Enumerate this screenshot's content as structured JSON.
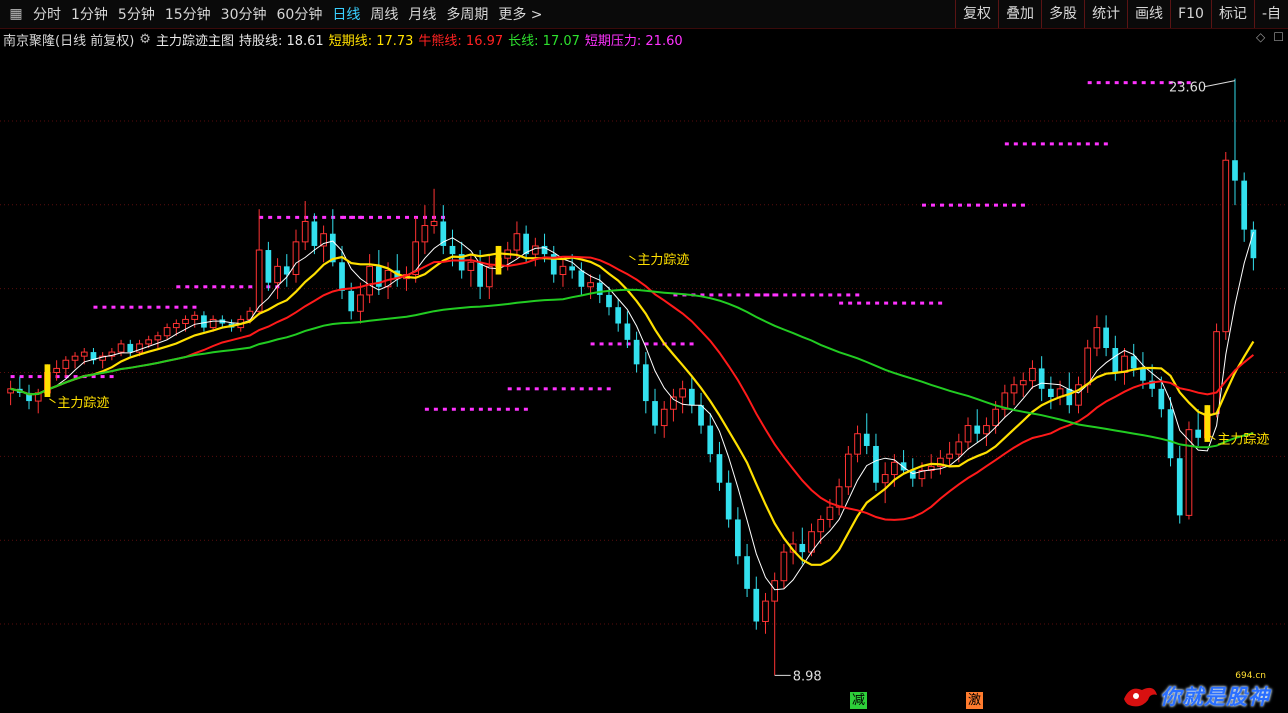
{
  "toolbar": {
    "periods": [
      "分时",
      "1分钟",
      "5分钟",
      "15分钟",
      "30分钟",
      "60分钟",
      "日线",
      "周线",
      "月线",
      "多周期",
      "更多 >"
    ],
    "active_period": "日线",
    "right_buttons": [
      "复权",
      "叠加",
      "多股",
      "统计",
      "画线",
      "F10",
      "标记",
      "-自"
    ]
  },
  "infobar": {
    "stock_name": "南京聚隆(日线 前复权)",
    "indicator_name": "主力踪迹主图",
    "fields": [
      {
        "label": "持股线:",
        "value": "18.61",
        "color": "#e8e8e8"
      },
      {
        "label": "短期线:",
        "value": "17.73",
        "color": "#ffe000"
      },
      {
        "label": "牛熊线:",
        "value": "16.97",
        "color": "#ff2222"
      },
      {
        "label": "长线:",
        "value": "17.07",
        "color": "#2ee02e"
      },
      {
        "label": "短期压力:",
        "value": "21.60",
        "color": "#ff33ff"
      }
    ]
  },
  "chart_data": {
    "type": "candlestick",
    "price_high_label": "23.60",
    "price_low_label": "8.98",
    "annotation_text": "主力踪迹",
    "colors": {
      "up": "#ff3333",
      "down": "#33e0ee",
      "hold_line": "#ffffff",
      "short_line": "#ffe000",
      "bull_bear_line": "#ff1a1a",
      "long_line": "#22cc22",
      "pressure": "#ff33ff"
    },
    "candles": [
      [
        15.9,
        16.2,
        15.6,
        16.0
      ],
      [
        16.0,
        16.3,
        15.8,
        15.9
      ],
      [
        15.9,
        16.1,
        15.5,
        15.7
      ],
      [
        15.7,
        16.0,
        15.4,
        15.9
      ],
      [
        15.9,
        16.6,
        15.8,
        16.4
      ],
      [
        16.4,
        16.7,
        16.2,
        16.5
      ],
      [
        16.5,
        16.8,
        16.3,
        16.7
      ],
      [
        16.7,
        16.9,
        16.5,
        16.8
      ],
      [
        16.8,
        17.0,
        16.6,
        16.9
      ],
      [
        16.9,
        17.0,
        16.6,
        16.7
      ],
      [
        16.7,
        16.9,
        16.5,
        16.8
      ],
      [
        16.8,
        17.0,
        16.7,
        16.9
      ],
      [
        16.9,
        17.2,
        16.8,
        17.1
      ],
      [
        17.1,
        17.2,
        16.8,
        16.9
      ],
      [
        16.9,
        17.2,
        16.8,
        17.1
      ],
      [
        17.1,
        17.3,
        17.0,
        17.2
      ],
      [
        17.2,
        17.4,
        17.0,
        17.3
      ],
      [
        17.3,
        17.6,
        17.2,
        17.5
      ],
      [
        17.5,
        17.7,
        17.3,
        17.6
      ],
      [
        17.6,
        17.8,
        17.4,
        17.7
      ],
      [
        17.7,
        17.9,
        17.5,
        17.8
      ],
      [
        17.8,
        17.9,
        17.4,
        17.5
      ],
      [
        17.5,
        17.8,
        17.4,
        17.7
      ],
      [
        17.7,
        17.8,
        17.5,
        17.6
      ],
      [
        17.6,
        17.7,
        17.4,
        17.5
      ],
      [
        17.5,
        17.8,
        17.4,
        17.7
      ],
      [
        17.7,
        18.0,
        17.6,
        17.9
      ],
      [
        17.9,
        20.4,
        17.8,
        19.4
      ],
      [
        19.4,
        19.6,
        18.4,
        18.6
      ],
      [
        18.6,
        19.2,
        18.2,
        19.0
      ],
      [
        19.0,
        19.3,
        18.5,
        18.8
      ],
      [
        18.8,
        19.9,
        18.6,
        19.6
      ],
      [
        19.6,
        20.6,
        19.4,
        20.1
      ],
      [
        20.1,
        20.3,
        19.3,
        19.5
      ],
      [
        19.5,
        20.0,
        19.1,
        19.8
      ],
      [
        19.8,
        20.4,
        19.0,
        19.1
      ],
      [
        19.1,
        19.5,
        18.2,
        18.4
      ],
      [
        18.4,
        18.6,
        17.7,
        17.9
      ],
      [
        17.9,
        18.6,
        17.6,
        18.3
      ],
      [
        18.3,
        19.3,
        18.1,
        19.0
      ],
      [
        19.0,
        19.4,
        18.3,
        18.5
      ],
      [
        18.5,
        19.1,
        18.2,
        18.9
      ],
      [
        18.9,
        19.3,
        18.5,
        18.7
      ],
      [
        18.7,
        19.0,
        18.4,
        18.8
      ],
      [
        18.8,
        20.2,
        18.6,
        19.6
      ],
      [
        19.6,
        20.5,
        19.3,
        20.0
      ],
      [
        20.0,
        20.9,
        19.8,
        20.1
      ],
      [
        20.1,
        20.5,
        19.3,
        19.5
      ],
      [
        19.5,
        19.9,
        19.0,
        19.3
      ],
      [
        19.3,
        19.6,
        18.7,
        18.9
      ],
      [
        18.9,
        19.3,
        18.5,
        19.1
      ],
      [
        19.1,
        19.4,
        18.2,
        18.5
      ],
      [
        18.5,
        19.3,
        18.2,
        19.0
      ],
      [
        19.0,
        19.5,
        18.8,
        19.2
      ],
      [
        19.2,
        19.6,
        18.9,
        19.4
      ],
      [
        19.4,
        20.1,
        19.2,
        19.8
      ],
      [
        19.8,
        20.0,
        19.1,
        19.3
      ],
      [
        19.3,
        19.7,
        19.0,
        19.5
      ],
      [
        19.5,
        19.8,
        19.1,
        19.3
      ],
      [
        19.3,
        19.5,
        18.6,
        18.8
      ],
      [
        18.8,
        19.2,
        18.5,
        19.0
      ],
      [
        19.0,
        19.3,
        18.7,
        18.9
      ],
      [
        18.9,
        19.1,
        18.3,
        18.5
      ],
      [
        18.5,
        18.8,
        18.2,
        18.6
      ],
      [
        18.6,
        18.8,
        18.1,
        18.3
      ],
      [
        18.3,
        18.5,
        17.8,
        18.0
      ],
      [
        18.0,
        18.2,
        17.4,
        17.6
      ],
      [
        17.6,
        17.9,
        17.0,
        17.2
      ],
      [
        17.2,
        17.4,
        16.4,
        16.6
      ],
      [
        16.6,
        16.9,
        15.4,
        15.7
      ],
      [
        15.7,
        16.0,
        14.9,
        15.1
      ],
      [
        15.1,
        15.7,
        14.8,
        15.5
      ],
      [
        15.5,
        16.0,
        15.2,
        15.8
      ],
      [
        15.8,
        16.2,
        15.4,
        16.0
      ],
      [
        16.0,
        16.3,
        15.4,
        15.6
      ],
      [
        15.6,
        15.9,
        14.9,
        15.1
      ],
      [
        15.1,
        15.4,
        14.2,
        14.4
      ],
      [
        14.4,
        14.7,
        13.5,
        13.7
      ],
      [
        13.7,
        14.0,
        12.6,
        12.8
      ],
      [
        12.8,
        13.1,
        11.7,
        11.9
      ],
      [
        11.9,
        12.2,
        10.9,
        11.1
      ],
      [
        11.1,
        11.4,
        10.1,
        10.3
      ],
      [
        10.3,
        11.0,
        10.0,
        10.8
      ],
      [
        10.8,
        11.5,
        8.98,
        11.3
      ],
      [
        11.3,
        12.2,
        11.1,
        12.0
      ],
      [
        12.0,
        12.5,
        11.7,
        12.2
      ],
      [
        12.2,
        12.6,
        11.7,
        12.0
      ],
      [
        12.0,
        12.7,
        11.9,
        12.5
      ],
      [
        12.5,
        12.9,
        12.2,
        12.8
      ],
      [
        12.8,
        13.3,
        12.6,
        13.1
      ],
      [
        13.1,
        13.8,
        12.9,
        13.6
      ],
      [
        13.6,
        14.6,
        13.4,
        14.4
      ],
      [
        14.4,
        15.1,
        14.2,
        14.9
      ],
      [
        14.9,
        15.4,
        14.4,
        14.6
      ],
      [
        14.6,
        14.9,
        13.5,
        13.7
      ],
      [
        13.7,
        14.2,
        13.2,
        13.9
      ],
      [
        13.9,
        14.4,
        13.6,
        14.2
      ],
      [
        14.2,
        14.5,
        13.9,
        14.0
      ],
      [
        14.0,
        14.3,
        13.6,
        13.8
      ],
      [
        13.8,
        14.2,
        13.6,
        14.0
      ],
      [
        14.0,
        14.4,
        13.8,
        14.1
      ],
      [
        14.1,
        14.5,
        13.9,
        14.3
      ],
      [
        14.3,
        14.7,
        14.1,
        14.4
      ],
      [
        14.4,
        14.9,
        14.2,
        14.7
      ],
      [
        14.7,
        15.3,
        14.5,
        15.1
      ],
      [
        15.1,
        15.5,
        14.7,
        14.9
      ],
      [
        14.9,
        15.3,
        14.6,
        15.1
      ],
      [
        15.1,
        15.7,
        14.9,
        15.5
      ],
      [
        15.5,
        16.1,
        15.3,
        15.9
      ],
      [
        15.9,
        16.3,
        15.6,
        16.1
      ],
      [
        16.1,
        16.4,
        15.8,
        16.2
      ],
      [
        16.2,
        16.7,
        16.0,
        16.5
      ],
      [
        16.5,
        16.8,
        15.7,
        16.0
      ],
      [
        16.0,
        16.3,
        15.5,
        15.8
      ],
      [
        15.8,
        16.2,
        15.6,
        16.0
      ],
      [
        16.0,
        16.4,
        15.4,
        15.6
      ],
      [
        15.6,
        16.3,
        15.4,
        16.1
      ],
      [
        16.1,
        17.2,
        15.9,
        17.0
      ],
      [
        17.0,
        17.8,
        16.8,
        17.5
      ],
      [
        17.5,
        17.8,
        16.8,
        17.0
      ],
      [
        17.0,
        17.3,
        16.2,
        16.4
      ],
      [
        16.4,
        17.0,
        16.1,
        16.8
      ],
      [
        16.8,
        17.1,
        16.3,
        16.5
      ],
      [
        16.5,
        16.9,
        16.0,
        16.2
      ],
      [
        16.2,
        16.6,
        15.8,
        16.0
      ],
      [
        16.0,
        16.3,
        15.3,
        15.5
      ],
      [
        15.5,
        15.8,
        14.1,
        14.3
      ],
      [
        14.3,
        14.6,
        12.7,
        12.9
      ],
      [
        12.9,
        15.2,
        12.8,
        15.0
      ],
      [
        15.0,
        15.5,
        14.6,
        14.8
      ],
      [
        14.8,
        15.6,
        14.7,
        15.4
      ],
      [
        15.4,
        17.6,
        15.3,
        17.4
      ],
      [
        17.4,
        21.8,
        17.2,
        21.6
      ],
      [
        21.6,
        23.6,
        20.5,
        21.1
      ],
      [
        21.1,
        21.3,
        19.6,
        19.9
      ],
      [
        19.9,
        20.1,
        18.9,
        19.2
      ]
    ],
    "pressure_levels": [
      16.3,
      18.0,
      18.5,
      20.2,
      20.2,
      15.5,
      16.0,
      17.1,
      18.3,
      18.3,
      18.1,
      20.5,
      22.0,
      23.5
    ],
    "ylim": [
      8.5,
      24.3
    ]
  },
  "watermark": {
    "brand": "你就是股神",
    "domain": "694.cn"
  },
  "signals": {
    "jian": "减",
    "ji": "激"
  }
}
